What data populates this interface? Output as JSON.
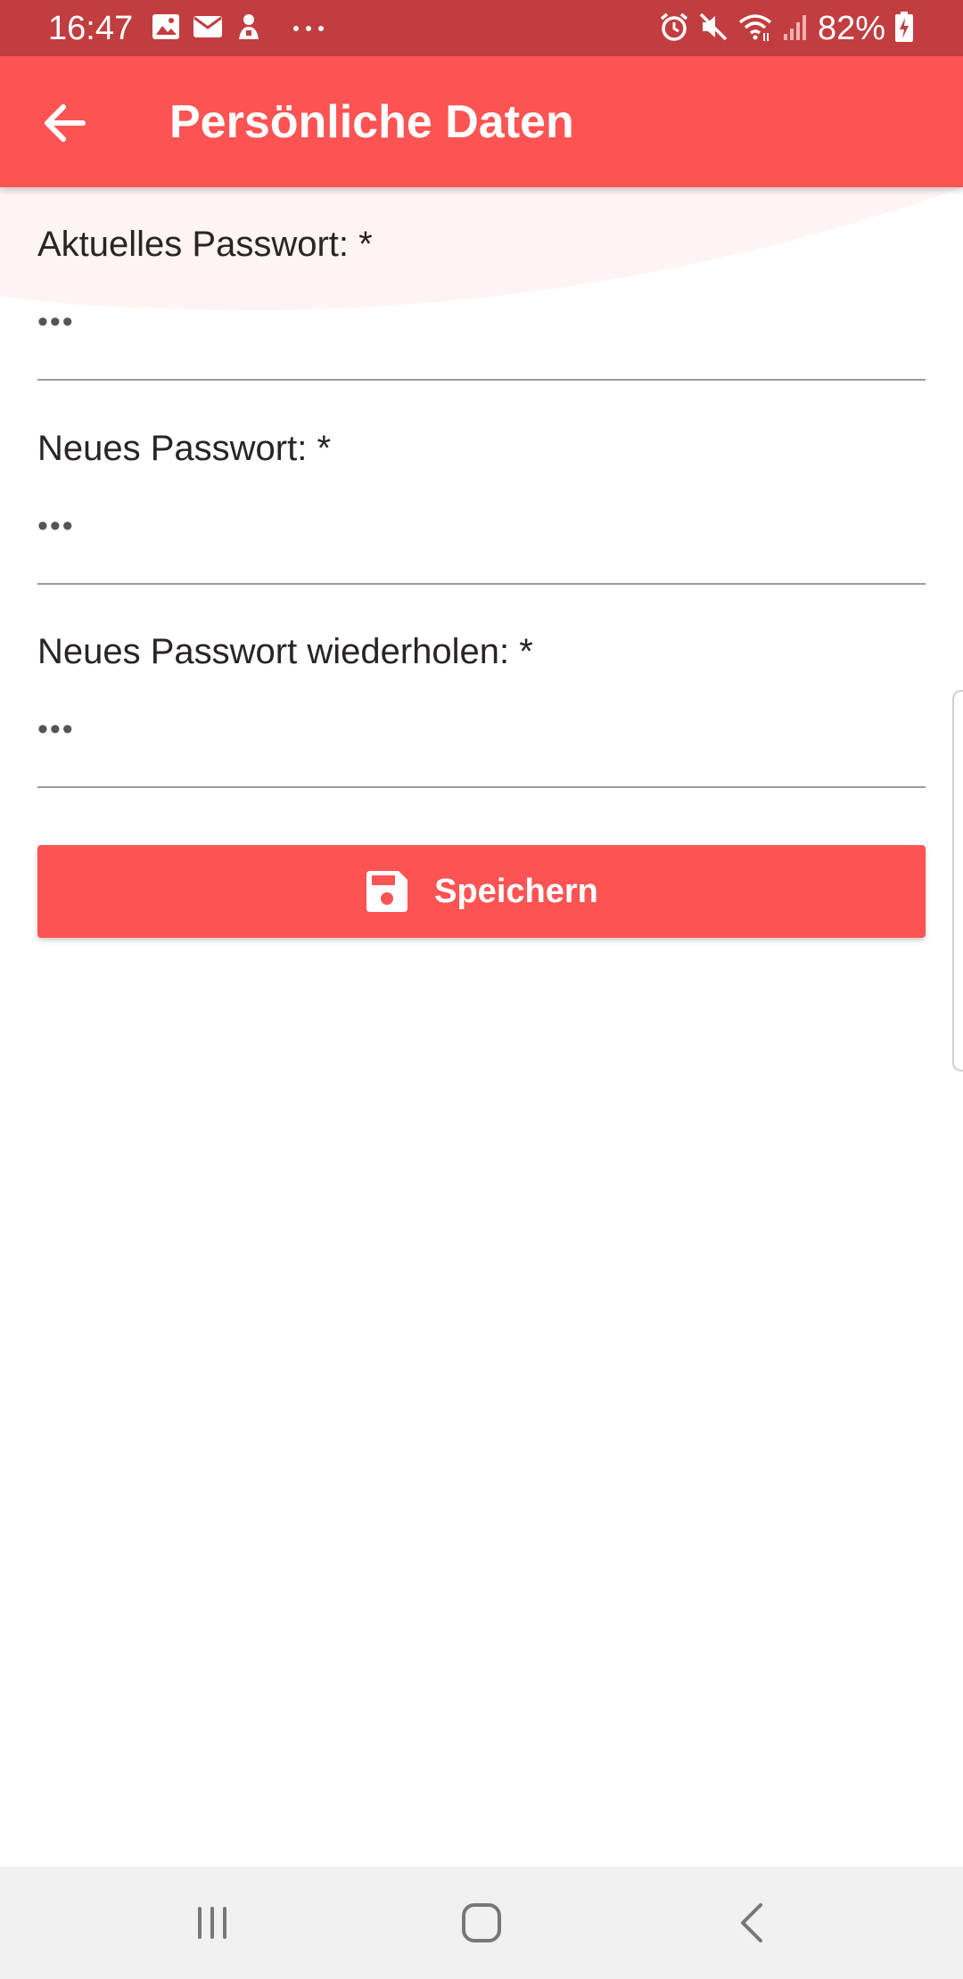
{
  "status_bar": {
    "time": "16:47",
    "battery": "82%",
    "left_icons": [
      "image-icon",
      "mail-icon",
      "app-notification-icon",
      "more-dots-icon"
    ],
    "right_icons": [
      "alarm-icon",
      "mute-icon",
      "wifi-icon",
      "signal-icon",
      "battery-charging-icon"
    ],
    "color": "#c13d3f"
  },
  "app_bar": {
    "title": "Persönliche Daten",
    "back_icon": "arrow-back-icon",
    "color": "#fd5353"
  },
  "form": {
    "fields": [
      {
        "label": "Aktuelles Passwort: *",
        "value": "•••"
      },
      {
        "label": "Neues Passwort: *",
        "value": "•••"
      },
      {
        "label": "Neues Passwort wiederholen: *",
        "value": "•••"
      }
    ],
    "save_button": {
      "label": "Speichern",
      "icon": "save-icon"
    }
  },
  "nav_bar": {
    "buttons": [
      "recent-apps-icon",
      "home-icon",
      "back-icon"
    ]
  }
}
